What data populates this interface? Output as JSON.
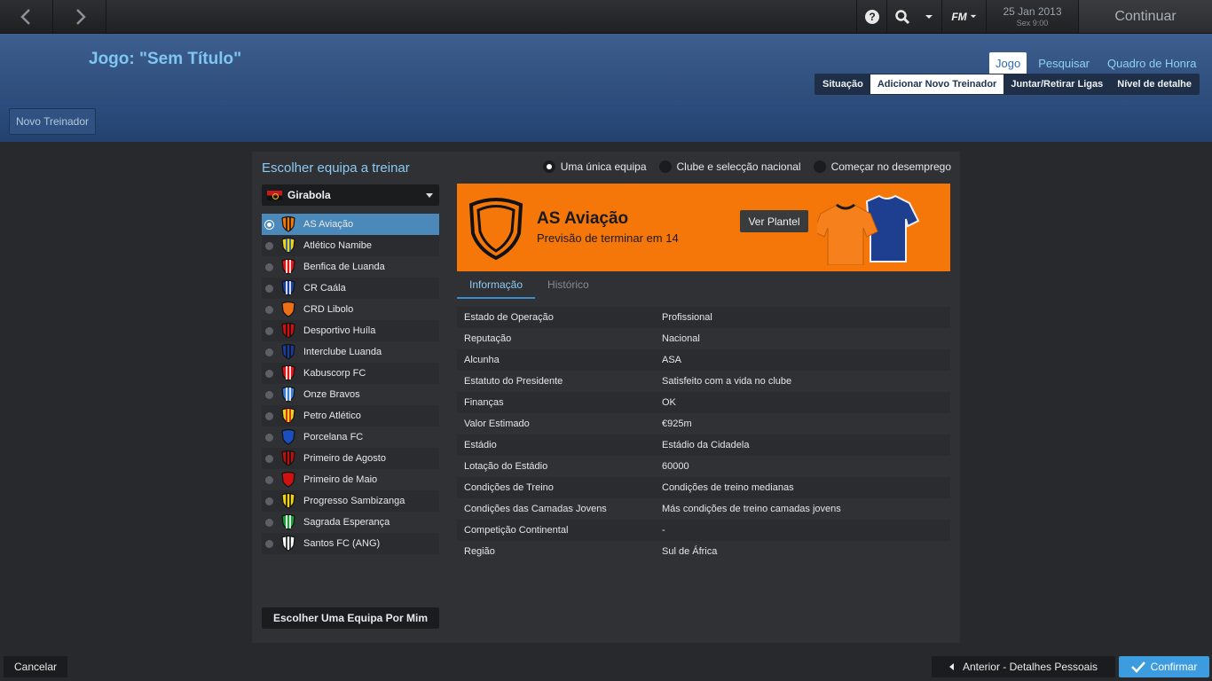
{
  "topbar": {
    "date": "25 Jan 2013",
    "time": "Sex 9:00",
    "continue_label": "Continuar",
    "fm_label": "FM",
    "icons": [
      "back-arrow-icon",
      "forward-arrow-icon",
      "help-icon",
      "search-icon",
      "dropdown-icon",
      "fm-menu-icon"
    ]
  },
  "header": {
    "title": "Jogo: \"Sem Título\"",
    "nav": [
      "Jogo",
      "Pesquisar",
      "Quadro de Honra"
    ],
    "subtabs": [
      "Situação",
      "Adicionar Novo Treinador",
      "Juntar/Retirar Ligas",
      "Nível de detalhe"
    ]
  },
  "toolbar": {
    "new_manager_label": "Novo Treinador"
  },
  "panel": {
    "title": "Escolher equipa a treinar",
    "modes": [
      "Uma única equipa",
      "Clube e selecção nacional",
      "Começar no desemprego"
    ],
    "league": "Girabola",
    "choose_for_me": "Escolher Uma Equipa Por Mim"
  },
  "teams": [
    {
      "name": "AS Aviação",
      "color": "#f5770a",
      "color2": "#111111"
    },
    {
      "name": "Atlético Namibe",
      "color": "#f2d51b",
      "color2": "#1a4fa8"
    },
    {
      "name": "Benfica de Luanda",
      "color": "#e01616",
      "color2": "#ffffff"
    },
    {
      "name": "CR Caála",
      "color": "#1b3fa0",
      "color2": "#ffffff"
    },
    {
      "name": "CRD Libolo",
      "color": "#ef6f16",
      "color2": "#ef6f16"
    },
    {
      "name": "Desportivo Huíla",
      "color": "#d01111",
      "color2": "#111111"
    },
    {
      "name": "Interclube Luanda",
      "color": "#1b3a9a",
      "color2": "#111111"
    },
    {
      "name": "Kabuscorp FC",
      "color": "#e01616",
      "color2": "#ffffff"
    },
    {
      "name": "Onze Bravos",
      "color": "#3b7fd6",
      "color2": "#ffffff"
    },
    {
      "name": "Petro Atlético",
      "color": "#f2d51b",
      "color2": "#d01111"
    },
    {
      "name": "Porcelana FC",
      "color": "#1b4fc0",
      "color2": "#1b4fc0"
    },
    {
      "name": "Primeiro de Agosto",
      "color": "#b81111",
      "color2": "#111111"
    },
    {
      "name": "Primeiro de Maio",
      "color": "#d01111",
      "color2": "#d01111"
    },
    {
      "name": "Progresso Sambizanga",
      "color": "#f2d51b",
      "color2": "#111111"
    },
    {
      "name": "Sagrada Esperança",
      "color": "#1e9a3a",
      "color2": "#ffffff"
    },
    {
      "name": "Santos FC (ANG)",
      "color": "#ffffff",
      "color2": "#111111"
    }
  ],
  "selected_team": {
    "name": "AS Aviação",
    "prediction": "Previsão de terminar em 14",
    "squad_button": "Ver Plantel",
    "tabs": [
      "Informação",
      "Histórico"
    ]
  },
  "info": [
    {
      "k": "Estado de Operação",
      "v": "Profissional"
    },
    {
      "k": "Reputação",
      "v": "Nacional"
    },
    {
      "k": "Alcunha",
      "v": "ASA"
    },
    {
      "k": "Estatuto do Presidente",
      "v": "Satisfeito com a vida no clube"
    },
    {
      "k": "Finanças",
      "v": "OK"
    },
    {
      "k": "Valor Estimado",
      "v": "€925m"
    },
    {
      "k": "Estádio",
      "v": "Estádio da Cidadela"
    },
    {
      "k": "Lotação do Estádio",
      "v": "60000"
    },
    {
      "k": "Condições de Treino",
      "v": "Condições de treino medianas"
    },
    {
      "k": "Condições das Camadas Jovens",
      "v": "Más condições de treino camadas jovens"
    },
    {
      "k": "Competição Continental",
      "v": "-"
    },
    {
      "k": "Região",
      "v": "Sul de África"
    }
  ],
  "footer": {
    "cancel": "Cancelar",
    "previous": "Anterior - Detalhes Pessoais",
    "confirm": "Confirmar"
  }
}
